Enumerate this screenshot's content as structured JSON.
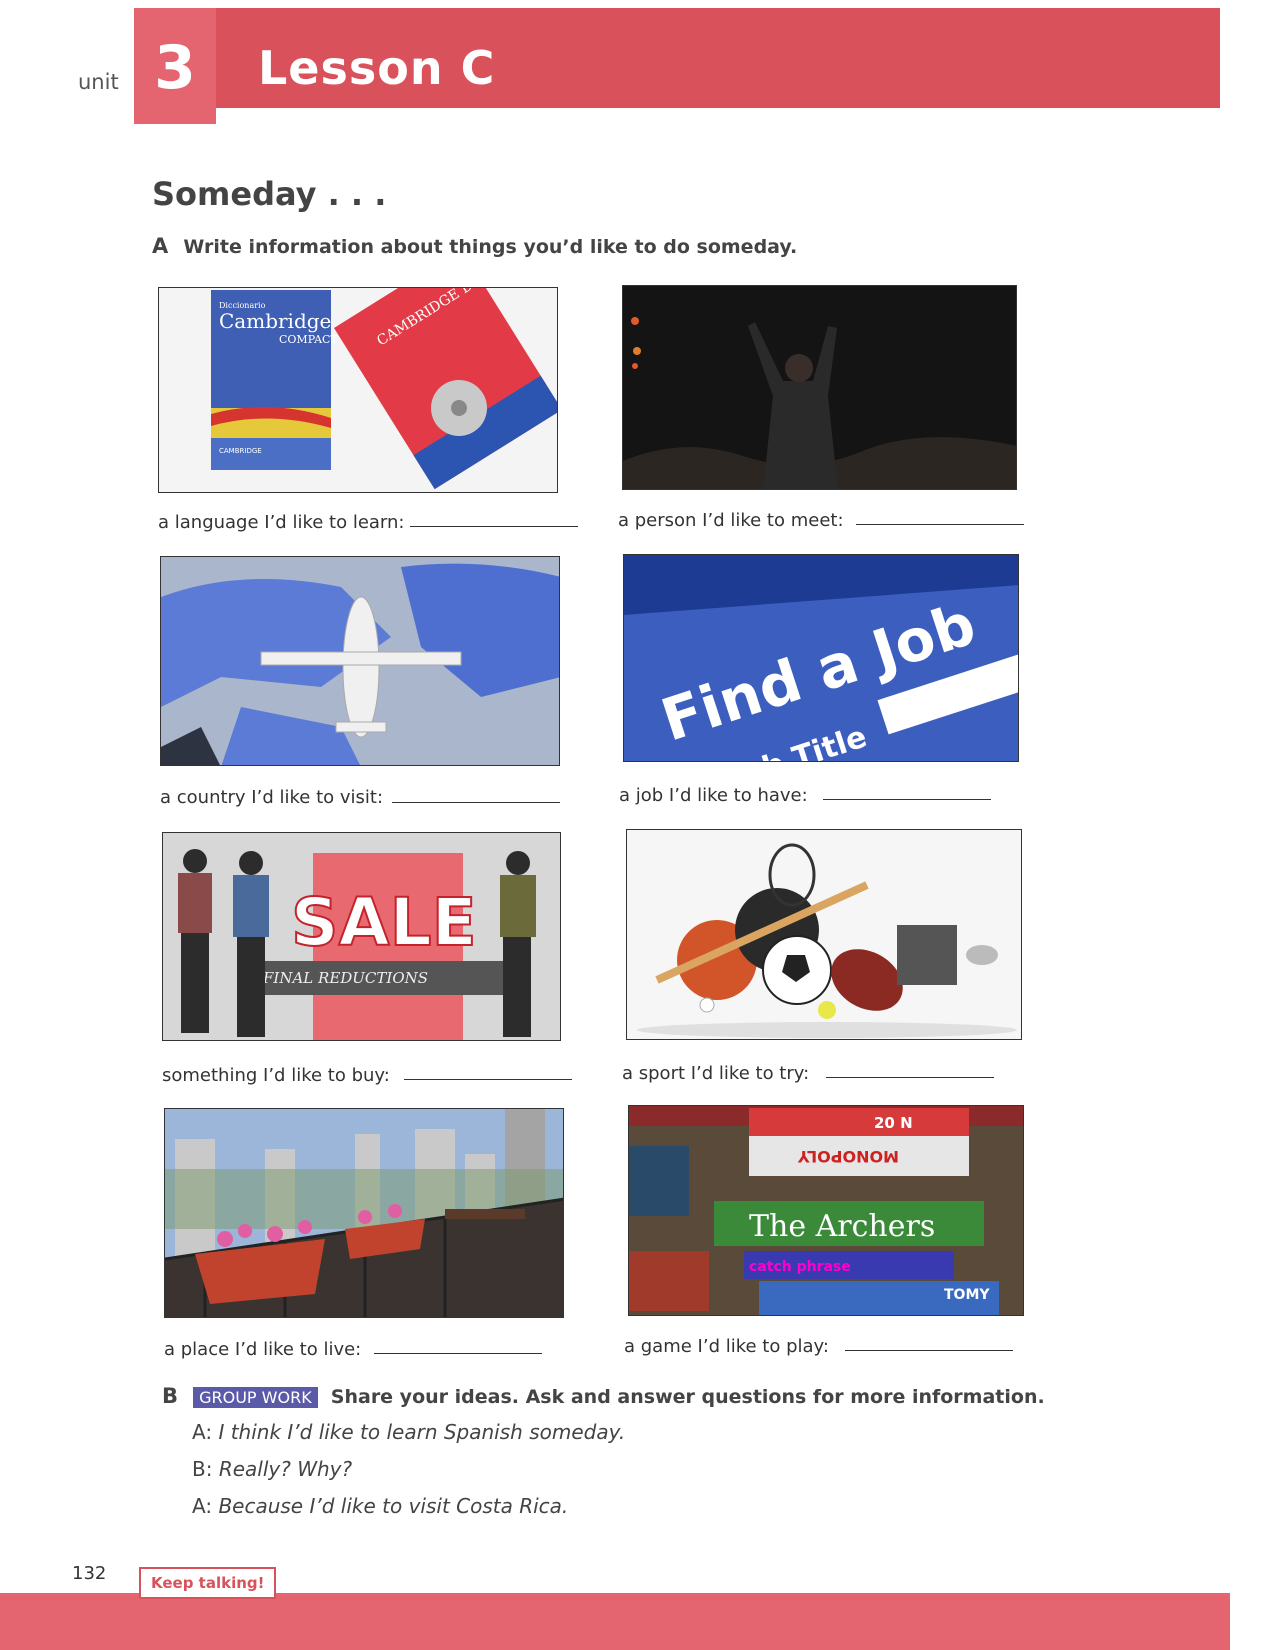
{
  "header": {
    "unit_label": "unit",
    "unit_number": "3",
    "lesson_title": "Lesson C",
    "accent_color": "#d9525b"
  },
  "section": {
    "title": "Someday . . .",
    "exercise_a": {
      "letter": "A",
      "instruction": "Write information about things you’d like to do someday."
    },
    "items": [
      {
        "caption": "a language I’d like to learn:",
        "image": "dictionaries-photo"
      },
      {
        "caption": "a person I’d like to meet:",
        "image": "concert-singer-photo"
      },
      {
        "caption": "a country I’d like to visit:",
        "image": "airplane-world-map-photo"
      },
      {
        "caption": "a job I’d like to have:",
        "image": "find-a-job-photo"
      },
      {
        "caption": "something I’d like to buy:",
        "image": "store-sale-window-photo"
      },
      {
        "caption": "a sport I’d like to try:",
        "image": "sports-equipment-photo"
      },
      {
        "caption": "a place I’d like to live:",
        "image": "city-balcony-photo"
      },
      {
        "caption": "a game I’d like to play:",
        "image": "board-games-photo"
      }
    ],
    "image_text": {
      "dict_small": "Diccionario",
      "dict_brand": "Cambridge",
      "dict_compact": "COMPACT",
      "dict_red": "CAMBRIDGE Dictionary of American English",
      "dict_logo": "CAMBRIDGE",
      "job_title": "Find a Job",
      "job_subtitle": "b Title",
      "sale": "SALE",
      "final_reductions": "FINAL REDUCTIONS",
      "archers": "The Archers",
      "monopoly": "MONOPOLY",
      "catch_phrase": "catch phrase",
      "tomy": "TOMY",
      "price": "20 N"
    },
    "exercise_b": {
      "letter": "B",
      "badge": "GROUP WORK",
      "instruction": "Share your ideas. Ask and answer questions for more information.",
      "dialog": [
        {
          "speaker": "A:",
          "line": "I think I’d like to learn Spanish someday."
        },
        {
          "speaker": "B:",
          "line": "Really? Why?"
        },
        {
          "speaker": "A:",
          "line": "Because I’d like to visit Costa Rica."
        }
      ]
    }
  },
  "footer": {
    "page_number": "132",
    "keep_talking": "Keep talking!"
  }
}
